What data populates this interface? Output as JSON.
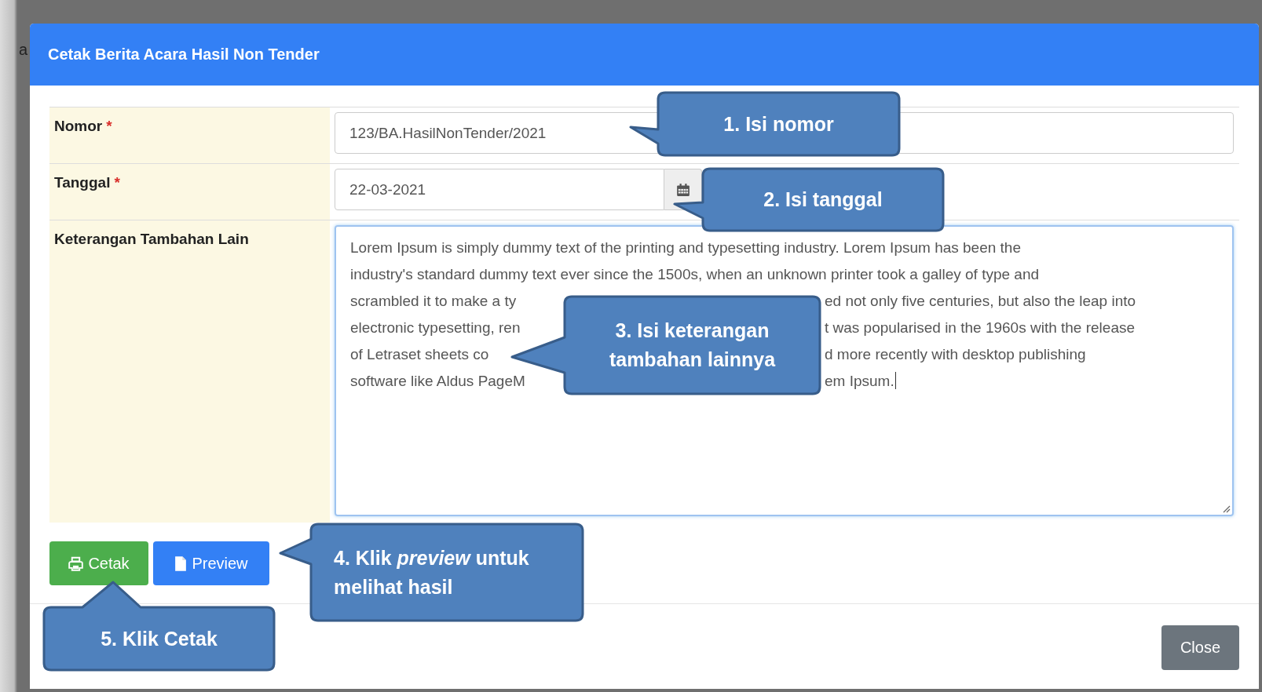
{
  "backdrop": {
    "text": "a"
  },
  "modal": {
    "title": "Cetak Berita Acara Hasil Non Tender"
  },
  "form": {
    "fields": [
      {
        "kind": "text",
        "label": "Nomor",
        "required_mark": "*",
        "value": "123/BA.HasilNonTender/2021"
      },
      {
        "kind": "date",
        "label": "Tanggal",
        "required_mark": "*",
        "value": "22-03-2021"
      },
      {
        "kind": "textarea",
        "label": "Keterangan Tambahan Lain",
        "lines": [
          {
            "left": "Lorem Ipsum is simply dummy text of the printing and typesetting industry. Lorem Ipsum has been the"
          },
          {
            "left": "industry's standard dummy text ever since the 1500s, when an unknown printer took a galley of type and"
          },
          {
            "left": "scrambled it to make a ty",
            "right": "ed not only five centuries, but also the leap into"
          },
          {
            "left": "electronic typesetting, ren",
            "right": "t was popularised in the 1960s with the release"
          },
          {
            "left": "of Letraset sheets co",
            "right": "d more recently with desktop publishing"
          },
          {
            "left": "software like Aldus PageM",
            "right": "em Ipsum."
          }
        ]
      }
    ]
  },
  "buttons": [
    {
      "kind": "print",
      "label": "Cetak"
    },
    {
      "kind": "preview",
      "label": "Preview"
    }
  ],
  "footer": {
    "close": "Close"
  },
  "callouts": [
    {
      "lines": [
        "1. Isi nomor"
      ]
    },
    {
      "lines": [
        "2. Isi tanggal"
      ]
    },
    {
      "lines": [
        "3. Isi keterangan",
        "tambahan lainnya"
      ]
    },
    {
      "lines": [
        "4. Klik *preview* untuk",
        "melihat hasil"
      ]
    },
    {
      "lines": [
        "5. Klik Cetak"
      ]
    }
  ]
}
